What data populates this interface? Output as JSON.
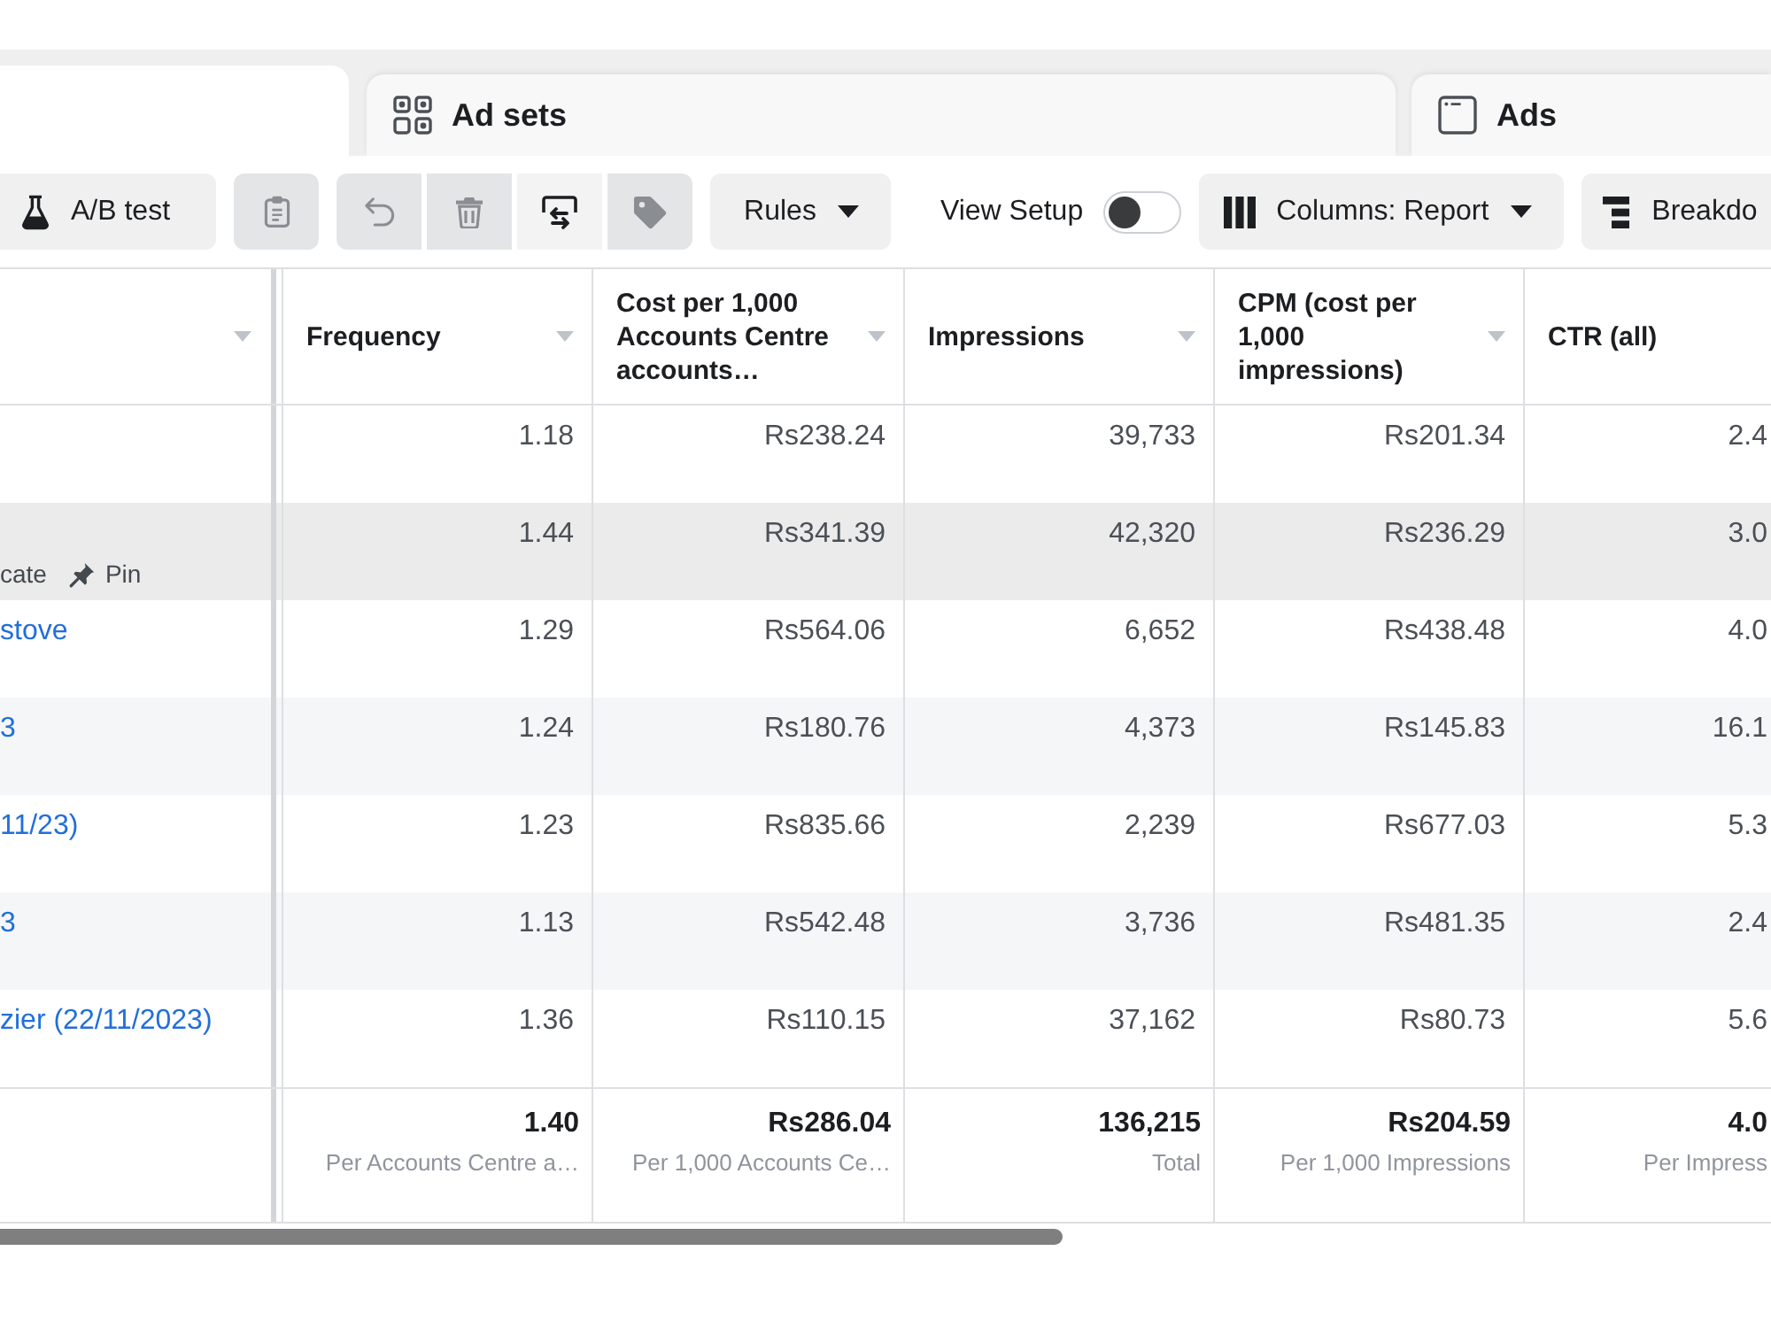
{
  "tabs": [
    {
      "selected": true
    },
    {
      "label": "Ad sets",
      "selected": false
    },
    {
      "label": "Ads",
      "selected": false
    }
  ],
  "toolbar": {
    "groups": [
      {
        "items": [
          {
            "kind": "button",
            "label": "A/B test"
          }
        ]
      },
      {
        "items": [
          {
            "kind": "icon",
            "disabled": true
          }
        ]
      },
      {
        "items": [
          {
            "kind": "icon",
            "disabled": true
          },
          {
            "kind": "icon",
            "disabled": true
          },
          {
            "kind": "icon",
            "disabled": false
          },
          {
            "kind": "icon",
            "disabled": true
          }
        ]
      },
      {
        "items": [
          {
            "kind": "dropdown",
            "label": "Rules"
          }
        ]
      },
      {
        "items": [
          {
            "kind": "toggle",
            "label": "View Setup",
            "on": false
          }
        ]
      },
      {
        "items": [
          {
            "kind": "dropdown",
            "label": "Columns: Report"
          }
        ]
      },
      {
        "items": [
          {
            "kind": "button",
            "label": "Breakdo"
          }
        ]
      }
    ]
  },
  "table": {
    "columns": [
      {
        "sortable": true
      },
      {
        "label": "Frequency",
        "sortable": true
      },
      {
        "label": "Cost per 1,000 Accounts Centre accounts…",
        "sortable": true
      },
      {
        "label": "Impressions",
        "sortable": true
      },
      {
        "label": "CPM (cost per 1,000 impressions)",
        "sortable": true
      },
      {
        "label": "CTR (all)",
        "sortable": false
      }
    ],
    "rows": [
      {
        "hovered": false,
        "cells": [
          "1.18",
          "Rs238.24",
          "39,733",
          "Rs201.34",
          "2.4"
        ]
      },
      {
        "hovered": true,
        "actions": [
          {
            "label": "cate",
            "icon": false
          },
          {
            "label": "Pin",
            "icon": true
          }
        ],
        "cells": [
          "1.44",
          "Rs341.39",
          "42,320",
          "Rs236.29",
          "3.0"
        ]
      },
      {
        "hovered": false,
        "name": "stove",
        "cells": [
          "1.29",
          "Rs564.06",
          "6,652",
          "Rs438.48",
          "4.0"
        ]
      },
      {
        "hovered": false,
        "name": "3",
        "cells": [
          "1.24",
          "Rs180.76",
          "4,373",
          "Rs145.83",
          "16.1"
        ]
      },
      {
        "hovered": false,
        "name": "11/23)",
        "cells": [
          "1.23",
          "Rs835.66",
          "2,239",
          "Rs677.03",
          "5.3"
        ]
      },
      {
        "hovered": false,
        "name": "3",
        "cells": [
          "1.13",
          "Rs542.48",
          "3,736",
          "Rs481.35",
          "2.4"
        ]
      },
      {
        "hovered": false,
        "name": "zier (22/11/2023)",
        "cells": [
          "1.36",
          "Rs110.15",
          "37,162",
          "Rs80.73",
          "5.6"
        ]
      }
    ],
    "summary": [
      {
        "value": "1.40",
        "note": "Per Accounts Centre a…"
      },
      {
        "value": "Rs286.04",
        "note": "Per 1,000 Accounts Ce…"
      },
      {
        "value": "136,215",
        "note": "Total"
      },
      {
        "value": "Rs204.59",
        "note": "Per 1,000 Impressions"
      },
      {
        "value": "4.0",
        "note": "Per Impress"
      }
    ]
  }
}
